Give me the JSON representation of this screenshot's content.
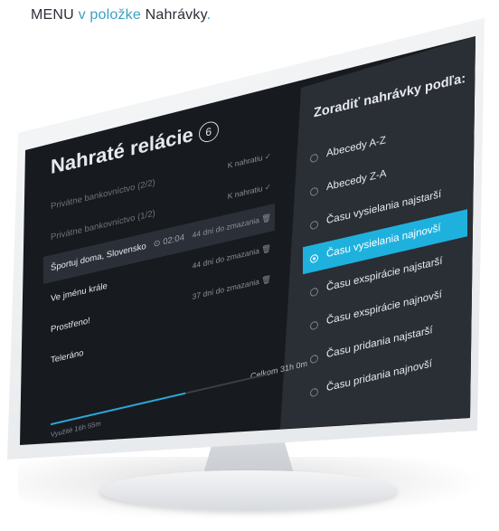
{
  "caption": {
    "prefix": "MENU",
    "middle": " v položke ",
    "suffix": "Nahrávky",
    "end": "."
  },
  "recordings": {
    "title": "Nahraté relácie",
    "count": "6",
    "items": [
      {
        "name": "Privátne bankovníctvo (2/2)",
        "status": "K nahratiu ✓",
        "dim": true
      },
      {
        "name": "Privátne bankovníctvo (1/2)",
        "status": "K nahratiu ✓",
        "dim": true
      },
      {
        "name": "Športuj doma, Slovensko",
        "duration": "⊙ 02:04",
        "status": "44 dní do zmazania 🗑",
        "selected": true
      },
      {
        "name": "Ve jménu krále",
        "status": "44 dní do zmazania 🗑"
      },
      {
        "name": "Prostřeno!",
        "status": "37 dní do zmazania 🗑"
      },
      {
        "name": "Teleráno",
        "status": ""
      }
    ],
    "used": "Využité 16h 55m",
    "total": "Celkom 31h 0m",
    "progress_fraction": 0.62
  },
  "sort": {
    "title": "Zoradiť nahrávky podľa:",
    "options": [
      {
        "label": "Abecedy A-Z",
        "selected": false
      },
      {
        "label": "Abecedy Z-A",
        "selected": false
      },
      {
        "label": "Času vysielania najstarší",
        "selected": false
      },
      {
        "label": "Času vysielania najnovší",
        "selected": true
      },
      {
        "label": "Času exspirácie najstarší",
        "selected": false
      },
      {
        "label": "Času exspirácie najnovší",
        "selected": false
      },
      {
        "label": "Času pridania najstarší",
        "selected": false
      },
      {
        "label": "Času pridania najnovší",
        "selected": false
      }
    ]
  },
  "colors": {
    "accent": "#1fb1de",
    "screen_bg": "#171a1f",
    "panel_bg": "#2a2e35"
  }
}
